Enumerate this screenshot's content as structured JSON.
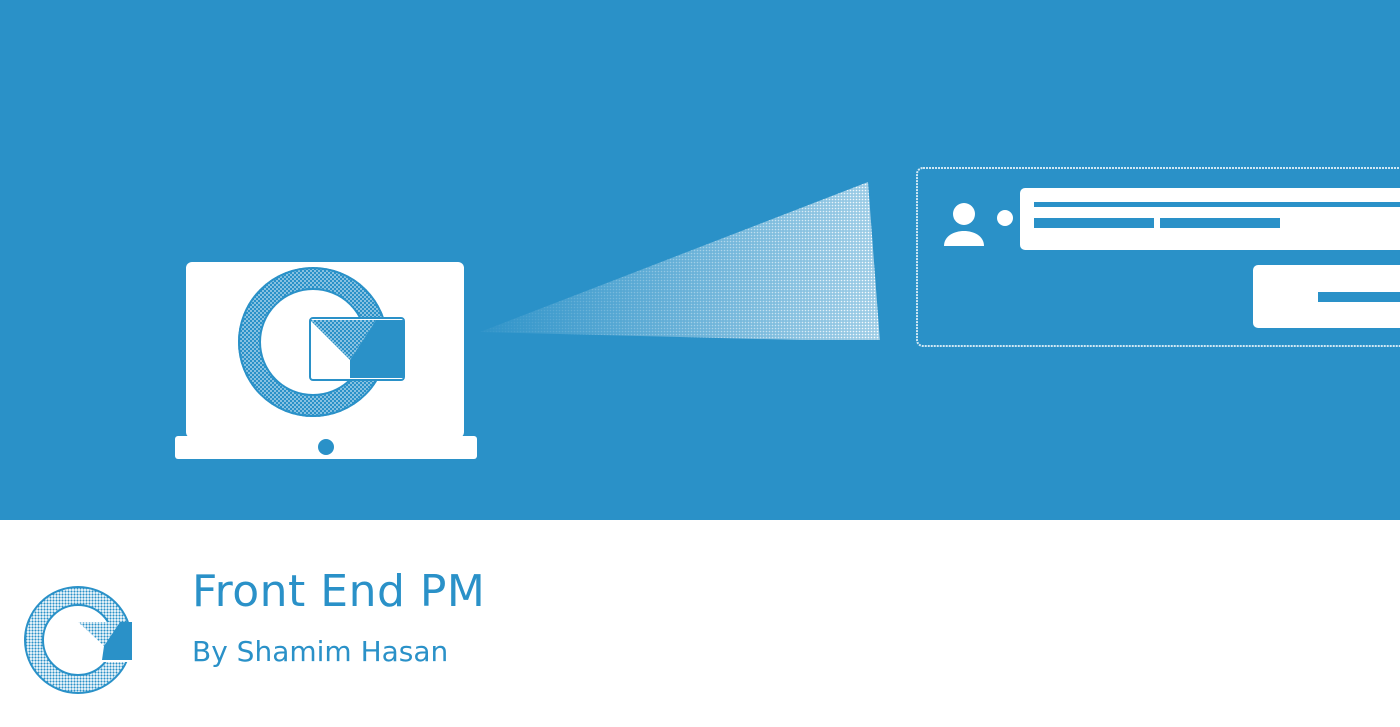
{
  "plugin": {
    "title": "Front End PM",
    "author": "By Shamim Hasan"
  },
  "colors": {
    "brand_blue": "#2a91c8",
    "white": "#ffffff"
  },
  "icons": {
    "banner_laptop": "laptop-icon",
    "banner_logo": "front-end-pm-logo-icon",
    "banner_user": "user-icon",
    "plugin_icon": "front-end-pm-logo-icon"
  }
}
